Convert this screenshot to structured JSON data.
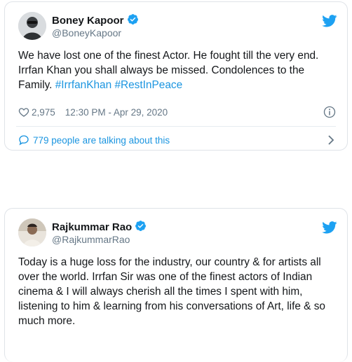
{
  "tweets": [
    {
      "author_name": "Boney Kapoor",
      "author_handle": "@BoneyKapoor",
      "text_main": "We have lost one of the finest Actor. He fought till the very end. Irrfan Khan you shall always be missed. Condolences to the Family. ",
      "hashtag_1": "#IrrfanKhan",
      "hashtag_2": "#RestInPeace",
      "likes": "2,975",
      "timestamp": "12:30 PM - Apr 29, 2020",
      "conversation": "779 people are talking about this",
      "avatar_icon": "avatar-photo"
    },
    {
      "author_name": "Rajkummar Rao",
      "author_handle": "@RajkummarRao",
      "text_main": "Today is a huge loss for the industry, our country & for artists all over the world. Irrfan Sir was one of the finest actors of Indian cinema & I will always cherish all the times I spent with him, listening to him & learning from his conversations of Art, life & so much more.",
      "avatar_icon": "avatar-photo"
    }
  ],
  "colors": {
    "accent": "#1b95e0",
    "text": "#14171a",
    "muted": "#657786",
    "verified": "#1da1f2"
  },
  "icons": [
    "verified-badge-icon",
    "twitter-bird-icon",
    "heart-icon",
    "info-icon",
    "comment-bubble-icon",
    "chevron-right-icon"
  ]
}
